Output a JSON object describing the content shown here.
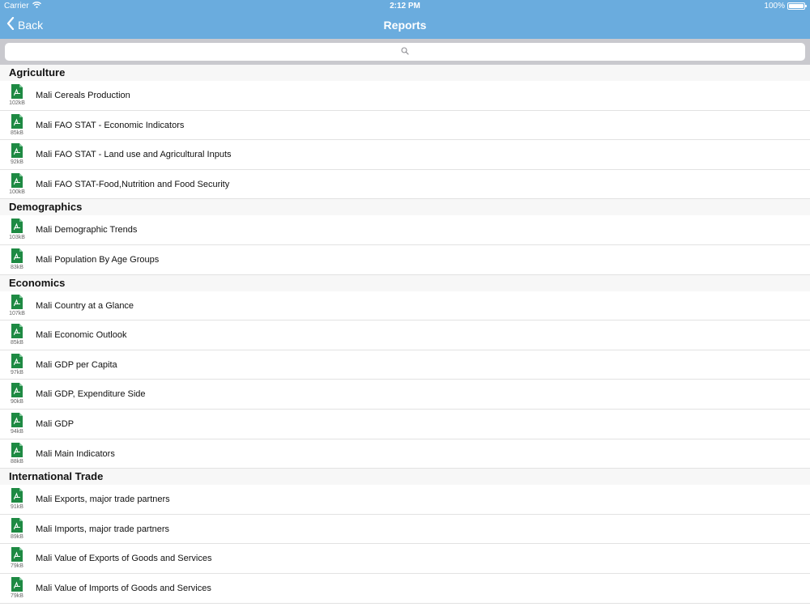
{
  "status": {
    "carrier": "Carrier",
    "time": "2:12 PM",
    "battery": "100%",
    "battery_level": 1.0
  },
  "nav": {
    "back_label": "Back",
    "title": "Reports"
  },
  "search": {
    "placeholder": ""
  },
  "sections": [
    {
      "title": "Agriculture",
      "items": [
        {
          "label": "Mali Cereals Production",
          "size": "102kB"
        },
        {
          "label": "Mali FAO STAT - Economic Indicators",
          "size": "85kB"
        },
        {
          "label": "Mali FAO STAT - Land use and Agricultural Inputs",
          "size": "92kB"
        },
        {
          "label": "Mali FAO STAT-Food,Nutrition and Food Security",
          "size": "100kB"
        }
      ]
    },
    {
      "title": "Demographics",
      "items": [
        {
          "label": "Mali Demographic Trends",
          "size": "103kB"
        },
        {
          "label": "Mali Population By Age Groups",
          "size": "83kB"
        }
      ]
    },
    {
      "title": "Economics",
      "items": [
        {
          "label": "Mali Country at a Glance",
          "size": "107kB"
        },
        {
          "label": "Mali Economic Outlook",
          "size": "85kB"
        },
        {
          "label": "Mali GDP per Capita",
          "size": "97kB"
        },
        {
          "label": "Mali GDP, Expenditure Side",
          "size": "90kB"
        },
        {
          "label": "Mali GDP",
          "size": "94kB"
        },
        {
          "label": "Mali Main Indicators",
          "size": "88kB"
        }
      ]
    },
    {
      "title": "International Trade",
      "items": [
        {
          "label": "Mali Exports, major trade partners",
          "size": "91kB"
        },
        {
          "label": "Mali Imports, major trade partners",
          "size": "89kB"
        },
        {
          "label": "Mali Value of Exports of Goods and Services",
          "size": "79kB"
        },
        {
          "label": "Mali Value of Imports of Goods and Services",
          "size": "79kB"
        }
      ]
    }
  ],
  "icons": {
    "file": "pdf-file-icon",
    "search": "search-icon",
    "back": "chevron-left-icon",
    "wifi": "wifi-icon",
    "battery": "battery-icon"
  },
  "colors": {
    "nav": "#6aacde",
    "pdf_icon": "#1e8a43",
    "section_bg": "#f7f7f7"
  }
}
